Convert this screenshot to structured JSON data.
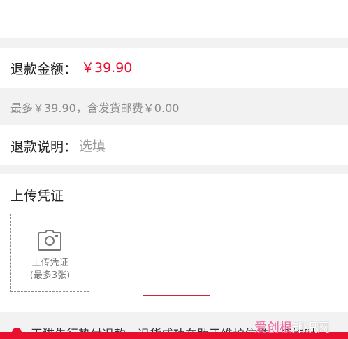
{
  "top": {
    "left_text": "",
    "right_text": ""
  },
  "refund_amount": {
    "label": "退款金额：",
    "value": "￥39.90"
  },
  "refund_hint": {
    "text": "最多￥39.90，含发货邮费￥0.00"
  },
  "refund_desc": {
    "label": "退款说明：",
    "placeholder": "选填"
  },
  "upload": {
    "title": "上传凭证",
    "box_line1": "上传凭证",
    "box_line2": "(最多3张)"
  },
  "notice": {
    "text": "天猫先行垫付退款，退货成功在助于维护信誉，请按时"
  },
  "watermark": {
    "part1": "爱创根",
    "part2": "知识网"
  },
  "colors": {
    "accent": "#e8102e",
    "background": "#f2f2f2"
  },
  "icons": {
    "arrow": "chevron-right-icon",
    "camera": "camera-icon"
  }
}
